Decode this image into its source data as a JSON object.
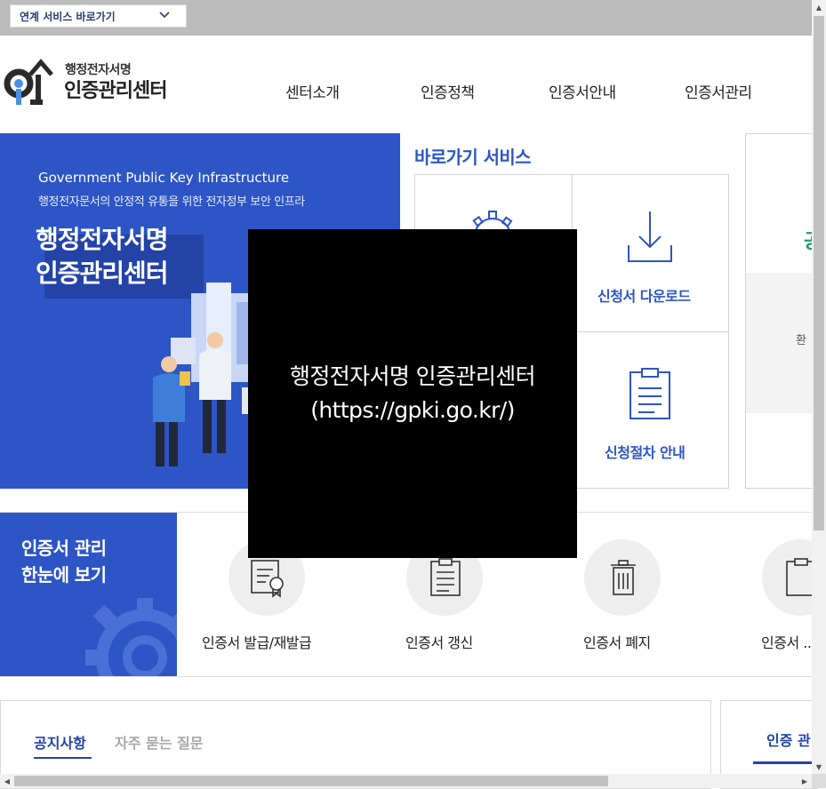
{
  "topbar": {
    "related_services": "연계 서비스 바로가기"
  },
  "header": {
    "logo_sub": "행정전자서명",
    "logo_main": "인증관리센터",
    "nav": [
      "센터소개",
      "인증정책",
      "인증서안내",
      "인증서관리"
    ]
  },
  "hero": {
    "subtitle_en": "Government Public Key Infrastructure",
    "subtitle_ko": "행정전자문서의 안정적 유통을 위한 전자정부 보안 인프라",
    "title_line1": "행정전자서명",
    "title_line2": "인증관리센터"
  },
  "quick_services": {
    "title": "바로가기 서비스",
    "items": [
      "신청서 다운로드",
      "신청절차 안내"
    ]
  },
  "right_panel": {
    "green_fragment": "공",
    "text_fragment": "환"
  },
  "cert_management": {
    "title_line1": "인증서 관리",
    "title_line2": "한눈에 보기",
    "items": [
      "인증서 발급/재발급",
      "인증서 갱신",
      "인증서 폐지",
      "인증서 ..."
    ]
  },
  "board": {
    "tabs": [
      "공지사항",
      "자주 묻는 질문"
    ],
    "right_tab": "인증 관"
  },
  "overlay": {
    "line1": "행정전자서명 인증관리센터",
    "line2": "(https://gpki.go.kr/)"
  },
  "colors": {
    "primary_blue": "#2d55c5",
    "dark_blue": "#2443a6",
    "green": "#1f9c6b"
  }
}
